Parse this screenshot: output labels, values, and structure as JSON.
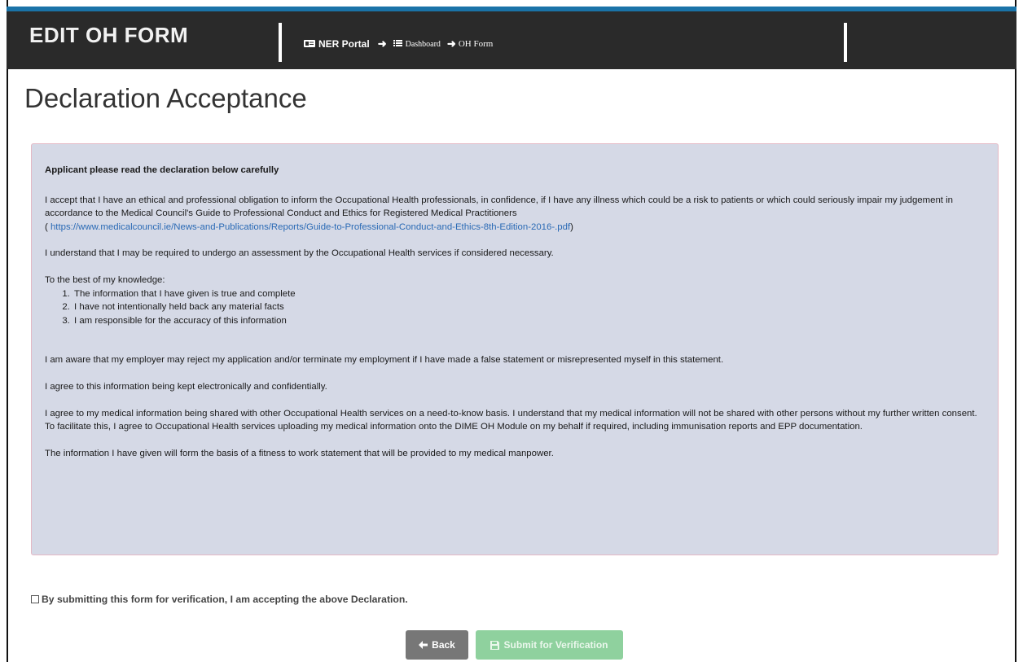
{
  "header": {
    "title": "EDIT OH FORM",
    "breadcrumb": [
      {
        "label": "NER Portal",
        "icon": "id-card-icon"
      },
      {
        "label": "Dashboard",
        "icon": "list-icon"
      },
      {
        "label": "OH Form",
        "icon": ""
      }
    ],
    "colors": {
      "background": "#2a2a2a",
      "accent_strip": "#1a73a8"
    }
  },
  "page_title": "Declaration Acceptance",
  "declaration": {
    "heading": "Applicant please read the declaration below carefully",
    "intro_text": "I accept that I have an ethical and professional obligation to inform the Occupational Health professionals, in confidence, if I have any illness which could be a risk to patients or which could seriously impair my judgement in accordance to the Medical Council's Guide to Professional Conduct and Ethics for Registered Medical Practitioners",
    "link_prefix": "( ",
    "link_url": "https://www.medicalcouncil.ie/News-and-Publications/Reports/Guide-to-Professional-Conduct-and-Ethics-8th-Edition-2016-.pdf",
    "link_suffix": ")",
    "assessment_text": "I understand that I may be required to undergo an assessment by the Occupational Health services if considered necessary.",
    "knowledge_intro": "To the best of my knowledge:",
    "knowledge_items": [
      "The information that I have given is true and complete",
      "I have not intentionally held back any material facts",
      "I am responsible for the accuracy of this information"
    ],
    "employer_text": "I am aware that my employer may reject my application and/or terminate my employment if I have made a false statement or misrepresented myself in this statement.",
    "storage_text": "I agree to this information being kept electronically and confidentially.",
    "sharing_text": "I agree to my medical information being shared with other Occupational Health services on a need-to-know basis. I understand that my medical information will not be shared with other persons without my further written consent. To facilitate this, I agree to Occupational Health services uploading my medical information onto the DIME OH Module on my behalf if required, including immunisation reports and EPP documentation.",
    "fitness_text": "The information I have given will form the basis of a fitness to work statement that will be provided to my medical manpower.",
    "colors": {
      "panel_background": "#d5d9e6",
      "panel_border": "#e3b8c4",
      "link": "#2a6ab5"
    }
  },
  "acceptance": {
    "checked": false,
    "label": "By submitting this form for verification, I am accepting the above Declaration."
  },
  "buttons": {
    "back": {
      "label": "Back",
      "icon": "arrow-left-icon",
      "color": "#777777"
    },
    "submit": {
      "label": "Submit for Verification",
      "icon": "save-icon",
      "color": "#8fd19e",
      "disabled": true
    }
  }
}
